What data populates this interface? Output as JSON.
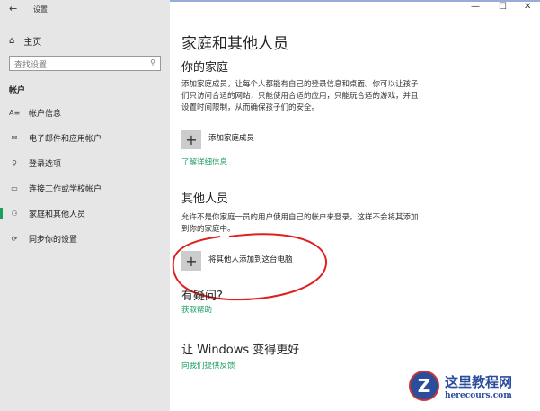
{
  "window": {
    "title": "设置",
    "minimize": "—",
    "maximize": "☐",
    "close": "✕",
    "back": "←"
  },
  "sidebar": {
    "home": "主页",
    "search_placeholder": "查找设置",
    "section": "帐户",
    "items": [
      {
        "label": "帐户信息",
        "icon": "A≡"
      },
      {
        "label": "电子邮件和应用帐户",
        "icon": "✉"
      },
      {
        "label": "登录选项",
        "icon": "⚲"
      },
      {
        "label": "连接工作或学校帐户",
        "icon": "▭"
      },
      {
        "label": "家庭和其他人员",
        "icon": "⚇"
      },
      {
        "label": "同步你的设置",
        "icon": "⟳"
      }
    ]
  },
  "main": {
    "title": "家庭和其他人员",
    "family_heading": "你的家庭",
    "family_desc": "添加家庭成员，让每个人都能有自己的登录信息和桌面。你可以让孩子们只访问合适的网站，只能使用合适的应用，只能玩合适的游戏，并且设置时间限制，从而确保孩子们的安全。",
    "add_family": "添加家庭成员",
    "learn_more": "了解详细信息",
    "others_heading": "其他人员",
    "others_desc": "允许不是你家庭一员的用户使用自己的帐户来登录。这样不会将其添加到你的家庭中。",
    "add_other": "将其他人添加到这台电脑",
    "question_heading": "有疑问?",
    "get_help": "获取帮助",
    "improve_heading": "让 Windows 变得更好",
    "feedback": "向我们提供反馈"
  },
  "watermark": {
    "name": "这里教程网",
    "url": "herecours.com",
    "letter": "Z"
  }
}
